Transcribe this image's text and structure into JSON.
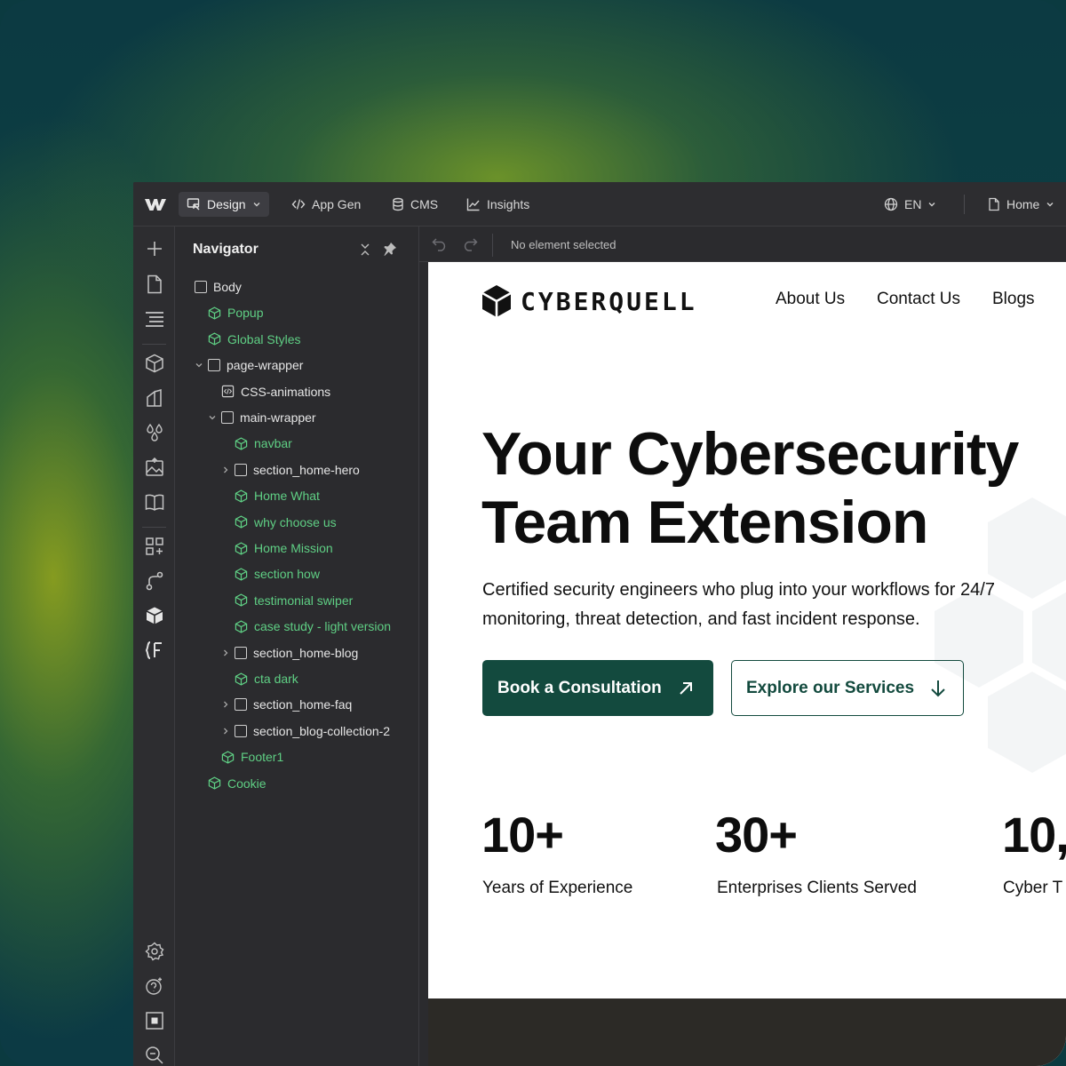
{
  "topbar": {
    "design_label": "Design",
    "appgen_label": "App Gen",
    "cms_label": "CMS",
    "insights_label": "Insights",
    "language": "EN",
    "page": "Home"
  },
  "canvas_bar": {
    "status": "No element selected"
  },
  "navigator": {
    "title": "Navigator",
    "items": [
      {
        "label": "Body",
        "type": "box",
        "depth": 0
      },
      {
        "label": "Popup",
        "type": "component",
        "depth": 1
      },
      {
        "label": "Global Styles",
        "type": "component",
        "depth": 1
      },
      {
        "label": "page-wrapper",
        "type": "box",
        "depth": 1,
        "expanded": true
      },
      {
        "label": "CSS-animations",
        "type": "embed",
        "depth": 2
      },
      {
        "label": "main-wrapper",
        "type": "box",
        "depth": 2,
        "expanded": true
      },
      {
        "label": "navbar",
        "type": "component",
        "depth": 3
      },
      {
        "label": "section_home-hero",
        "type": "box",
        "depth": 3,
        "collapsed": true
      },
      {
        "label": "Home What",
        "type": "component",
        "depth": 3
      },
      {
        "label": "why choose us",
        "type": "component",
        "depth": 3
      },
      {
        "label": "Home Mission",
        "type": "component",
        "depth": 3
      },
      {
        "label": "section how",
        "type": "component",
        "depth": 3
      },
      {
        "label": "testimonial swiper",
        "type": "component",
        "depth": 3
      },
      {
        "label": "case study - light version",
        "type": "component",
        "depth": 3
      },
      {
        "label": "section_home-blog",
        "type": "box",
        "depth": 3,
        "collapsed": true
      },
      {
        "label": "cta dark",
        "type": "component",
        "depth": 3
      },
      {
        "label": "section_home-faq",
        "type": "box",
        "depth": 3,
        "collapsed": true
      },
      {
        "label": "section_blog-collection-2",
        "type": "box",
        "depth": 3,
        "collapsed": true
      },
      {
        "label": "Footer1",
        "type": "component",
        "depth": 2
      },
      {
        "label": "Cookie",
        "type": "component",
        "depth": 1
      }
    ]
  },
  "site": {
    "brand": "CYBERQUELL",
    "nav": [
      "About Us",
      "Contact Us",
      "Blogs"
    ],
    "hero_title_line1": "Your Cybersecurity",
    "hero_title_line2": "Team Extension",
    "hero_sub_line1": "Certified security engineers who plug into your workflows for 24/7",
    "hero_sub_line2": "monitoring, threat detection, and fast incident response.",
    "primary_cta": "Book a Consultation",
    "secondary_cta": "Explore our Services",
    "stats": [
      {
        "value": "10+",
        "label": "Years of Experience"
      },
      {
        "value": "30+",
        "label": "Enterprises Clients Served"
      },
      {
        "value": "10,",
        "label": "Cyber T"
      }
    ]
  },
  "colors": {
    "component_green": "#5fcf84",
    "brand_dark_green": "#134a3e",
    "editor_bg": "#2b2b2e"
  }
}
